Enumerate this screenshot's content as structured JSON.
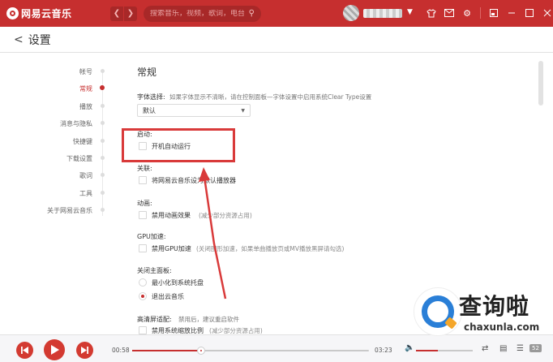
{
  "app": {
    "name": "网易云音乐",
    "accent": "#c62f2f"
  },
  "titlebar": {
    "search_placeholder": "搜索音乐，视频，歌词，电台",
    "icons": [
      "back-arrow-icon",
      "forward-arrow-icon",
      "search-icon",
      "skin-icon",
      "mail-icon",
      "settings-icon",
      "mini-mode-icon",
      "minimize-icon",
      "maximize-icon",
      "close-icon"
    ]
  },
  "header": {
    "back": "<",
    "title": "设置"
  },
  "sidebar": {
    "items": [
      {
        "label": "帐号",
        "active": false
      },
      {
        "label": "常规",
        "active": true
      },
      {
        "label": "播放",
        "active": false
      },
      {
        "label": "消息与隐私",
        "active": false
      },
      {
        "label": "快捷键",
        "active": false
      },
      {
        "label": "下载设置",
        "active": false
      },
      {
        "label": "歌词",
        "active": false
      },
      {
        "label": "工具",
        "active": false
      },
      {
        "label": "关于网易云音乐",
        "active": false
      }
    ]
  },
  "main": {
    "section_title": "常规",
    "font": {
      "label": "字体选择:",
      "hint": "如果字体显示不清晰，请在控制面板—字体设置中启用系统Clear Type设置",
      "selected": "默认"
    },
    "startup": {
      "label": "启动:",
      "option": "开机自动运行",
      "checked": false
    },
    "association": {
      "label": "关联:",
      "option": "将网易云音乐设为默认播放器",
      "checked": false
    },
    "animation": {
      "label": "动画:",
      "option": "禁用动画效果",
      "note": "(减少部分资源占用)",
      "checked": false
    },
    "gpu": {
      "label": "GPU加速:",
      "option": "禁用GPU加速",
      "note": "(关闭图形加速，如果单曲播放页或MV播放黑屏请勾选)",
      "checked": false
    },
    "close_panel": {
      "label": "关闭主面板:",
      "options": [
        {
          "label": "最小化到系统托盘",
          "selected": false
        },
        {
          "label": "退出云音乐",
          "selected": true
        }
      ]
    },
    "hidpi": {
      "label": "高清屏适配:",
      "hint": "禁用后，建议重启软件",
      "option": "禁用系统缩放比例",
      "note": "(减少部分资源占用)",
      "checked": false
    }
  },
  "player": {
    "current_time": "00:58",
    "total_time": "03:23",
    "progress": 0.29,
    "volume": 0.38,
    "playlist_count": "52",
    "icons": [
      "prev-icon",
      "play-icon",
      "next-icon",
      "volume-icon",
      "shuffle-icon",
      "lyrics-icon",
      "playlist-icon"
    ]
  },
  "watermark": {
    "text": "查询啦",
    "domain": "chaxunla.com"
  }
}
